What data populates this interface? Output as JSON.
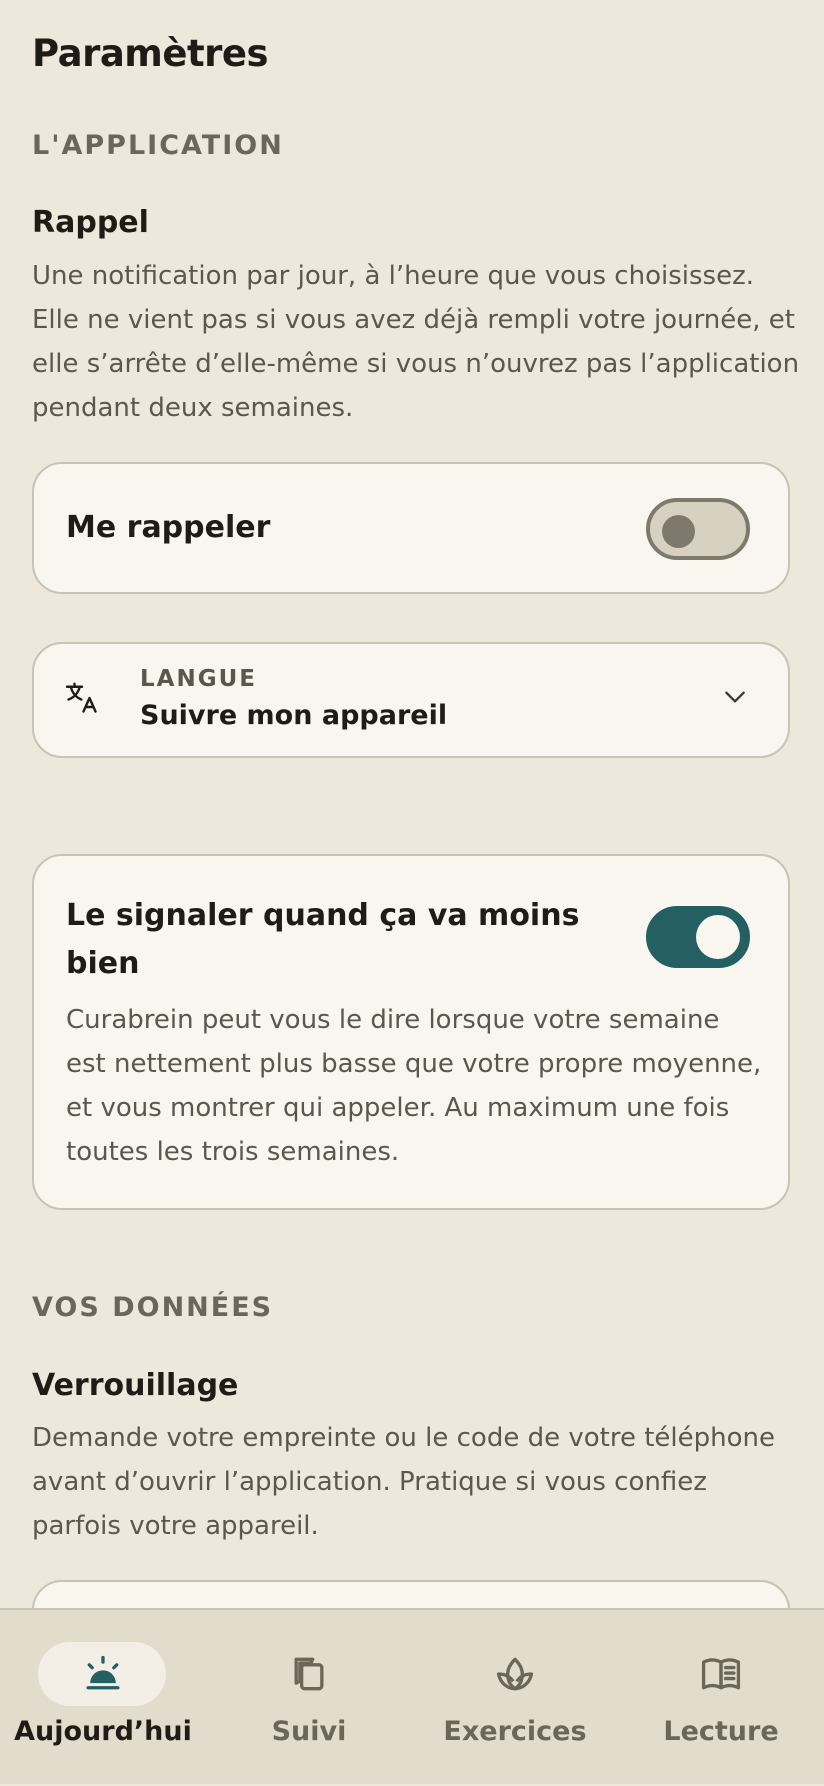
{
  "page": {
    "title": "Paramètres"
  },
  "app_section": {
    "label": "L'APPLICATION",
    "reminder": {
      "heading": "Rappel",
      "description": "Une notification par jour, à l’heure que vous choisissez. Elle ne vient pas si vous avez déjà rempli votre journée, et elle s’arrête d’elle-même si vous n’ouvrez pas l’application pendant deux semaines.",
      "toggle_label": "Me rappeler",
      "toggle_on": false
    },
    "language": {
      "label": "LANGUE",
      "value": "Suivre mon appareil",
      "icon": "translate-icon"
    },
    "alert": {
      "title": "Le signaler quand ça va moins bien",
      "description": "Curabrein peut vous le dire lorsque votre semaine est nettement plus basse que votre propre moyenne, et vous montrer qui appeler. Au maximum une fois toutes les trois semaines.",
      "toggle_on": true
    }
  },
  "data_section": {
    "label": "VOS DONNÉES",
    "lock": {
      "heading": "Verrouillage",
      "description": "Demande votre empreinte ou le code de votre téléphone avant d’ouvrir l’application. Pratique si vous confiez parfois votre appareil."
    }
  },
  "nav": {
    "items": [
      {
        "label": "Aujourd’hui",
        "icon": "sunrise-icon",
        "active": true
      },
      {
        "label": "Suivi",
        "icon": "cards-icon",
        "active": false
      },
      {
        "label": "Exercices",
        "icon": "lotus-icon",
        "active": false
      },
      {
        "label": "Lecture",
        "icon": "book-icon",
        "active": false
      }
    ]
  },
  "colors": {
    "background": "#ede7dc",
    "card": "#f9f6f0",
    "accent": "#246062",
    "text": "#1f1c17",
    "muted": "#5c574c"
  }
}
